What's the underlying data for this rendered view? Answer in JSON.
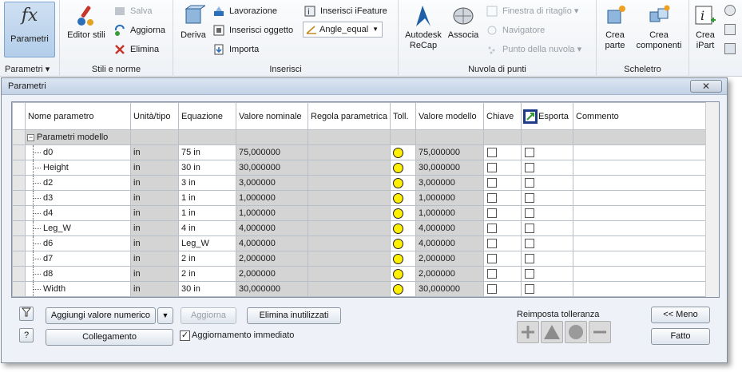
{
  "ribbon": {
    "parametri": {
      "label": "Parametri",
      "group": "Parametri ▾"
    },
    "stili": {
      "group": "Stili e norme",
      "editor_stili": "Editor stili",
      "salva": "Salva",
      "aggiorna": "Aggiorna",
      "elimina": "Elimina"
    },
    "inserisci": {
      "group": "Inserisci",
      "deriva": "Deriva",
      "lavorazione": "Lavorazione",
      "inserisci_oggetto": "Inserisci oggetto",
      "importa": "Importa",
      "inserisci_ifeature": "Inserisci iFeature",
      "angle_equal": "Angle_equal"
    },
    "nuvola": {
      "group": "Nuvola di punti",
      "autodesk_recap_1": "Autodesk",
      "autodesk_recap_2": "ReCap",
      "associa": "Associa",
      "finestra": "Finestra di ritaglio",
      "navigatore": "Navigatore",
      "punto": "Punto della nuvola"
    },
    "scheletro": {
      "group": "Scheletro",
      "crea_parte_1": "Crea",
      "crea_parte_2": "parte",
      "crea_comp_1": "Crea",
      "crea_comp_2": "componenti"
    },
    "ipart": {
      "crea_1": "Crea",
      "crea_2": "iPart"
    }
  },
  "dialog": {
    "title": "Parametri",
    "close": "✕",
    "columns": [
      "Nome parametro",
      "Unità/tipo",
      "Equazione",
      "Valore nominale",
      "Regola parametrica",
      "Toll.",
      "Valore modello",
      "Chiave",
      "Esporta",
      "Commento"
    ],
    "group_name": "Parametri modello",
    "rows": [
      {
        "name": "d0",
        "unit": "in",
        "eq": "75 in",
        "nominal": "75,000000",
        "model": "75,000000"
      },
      {
        "name": "Height",
        "unit": "in",
        "eq": "30 in",
        "nominal": "30,000000",
        "model": "30,000000"
      },
      {
        "name": "d2",
        "unit": "in",
        "eq": "3 in",
        "nominal": "3,000000",
        "model": "3,000000"
      },
      {
        "name": "d3",
        "unit": "in",
        "eq": "1 in",
        "nominal": "1,000000",
        "model": "1,000000"
      },
      {
        "name": "d4",
        "unit": "in",
        "eq": "1 in",
        "nominal": "1,000000",
        "model": "1,000000"
      },
      {
        "name": "Leg_W",
        "unit": "in",
        "eq": "4 in",
        "nominal": "4,000000",
        "model": "4,000000"
      },
      {
        "name": "d6",
        "unit": "in",
        "eq": "Leg_W",
        "nominal": "4,000000",
        "model": "4,000000"
      },
      {
        "name": "d7",
        "unit": "in",
        "eq": "2 in",
        "nominal": "2,000000",
        "model": "2,000000"
      },
      {
        "name": "d8",
        "unit": "in",
        "eq": "2 in",
        "nominal": "2,000000",
        "model": "2,000000"
      },
      {
        "name": "Width",
        "unit": "in",
        "eq": "30 in",
        "nominal": "30,000000",
        "model": "30,000000"
      }
    ],
    "footer": {
      "aggiungi": "Aggiungi valore numerico",
      "aggiorna": "Aggiorna",
      "elimina": "Elimina inutilizzati",
      "collegamento": "Collegamento",
      "aggiornamento": "Aggiornamento immediato",
      "reimposta": "Reimposta tolleranza",
      "meno": "<< Meno",
      "fatto": "Fatto",
      "help": "?"
    }
  },
  "colors": {
    "accent": "#b3cde9",
    "tol_bullet": "#ffef00",
    "cell_gray": "#d4d4d4"
  }
}
